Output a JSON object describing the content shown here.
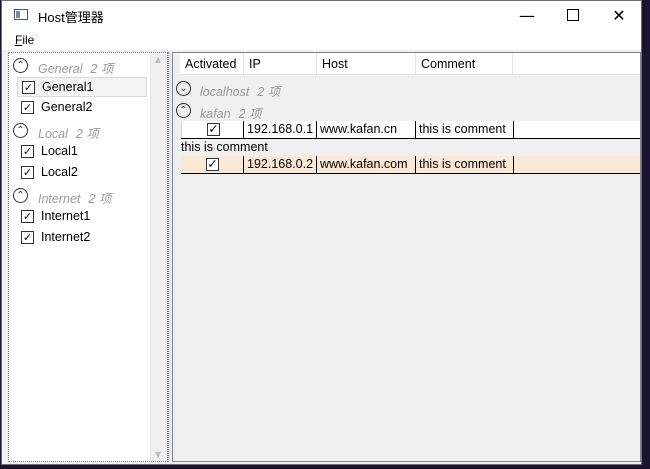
{
  "window": {
    "title": "Host管理器",
    "icon": "app-window-icon",
    "controls": {
      "minimize": "—",
      "maximize": "maximize-icon",
      "close": "✕"
    }
  },
  "menu": {
    "file_label": "File",
    "file_accel": "F",
    "file_rest": "ile"
  },
  "sidebar": {
    "groups": [
      {
        "name": "General",
        "count": "2 项",
        "expander": "up",
        "items": [
          {
            "label": "General1",
            "checked": true,
            "selected": true
          },
          {
            "label": "General2",
            "checked": true
          }
        ]
      },
      {
        "name": "Local",
        "count": "2 项",
        "expander": "up",
        "items": [
          {
            "label": "Local1",
            "checked": true
          },
          {
            "label": "Local2",
            "checked": true
          }
        ]
      },
      {
        "name": "Internet",
        "count": "2 项",
        "expander": "up",
        "items": [
          {
            "label": "Internet1",
            "checked": true
          },
          {
            "label": "Internet2",
            "checked": true
          }
        ]
      }
    ]
  },
  "grid": {
    "columns": [
      "Activated",
      "IP",
      "Host",
      "Comment"
    ],
    "groups": [
      {
        "name": "localhost",
        "count": "2 项",
        "expander": "down"
      },
      {
        "name": "kafan",
        "count": "2 项",
        "expander": "up"
      }
    ],
    "rows": [
      {
        "activated": true,
        "ip": "192.168.0.1",
        "host": "www.kafan.cn",
        "comment": "this is comment",
        "detail": "this is comment"
      },
      {
        "activated": true,
        "ip": "192.168.0.2",
        "host": "www.kafan.com",
        "comment": "this is comment"
      }
    ]
  },
  "colors": {
    "alt_row": "#fbe9d7",
    "group_text": "#9a9a9a",
    "window_bg": "#f0f0f0"
  }
}
